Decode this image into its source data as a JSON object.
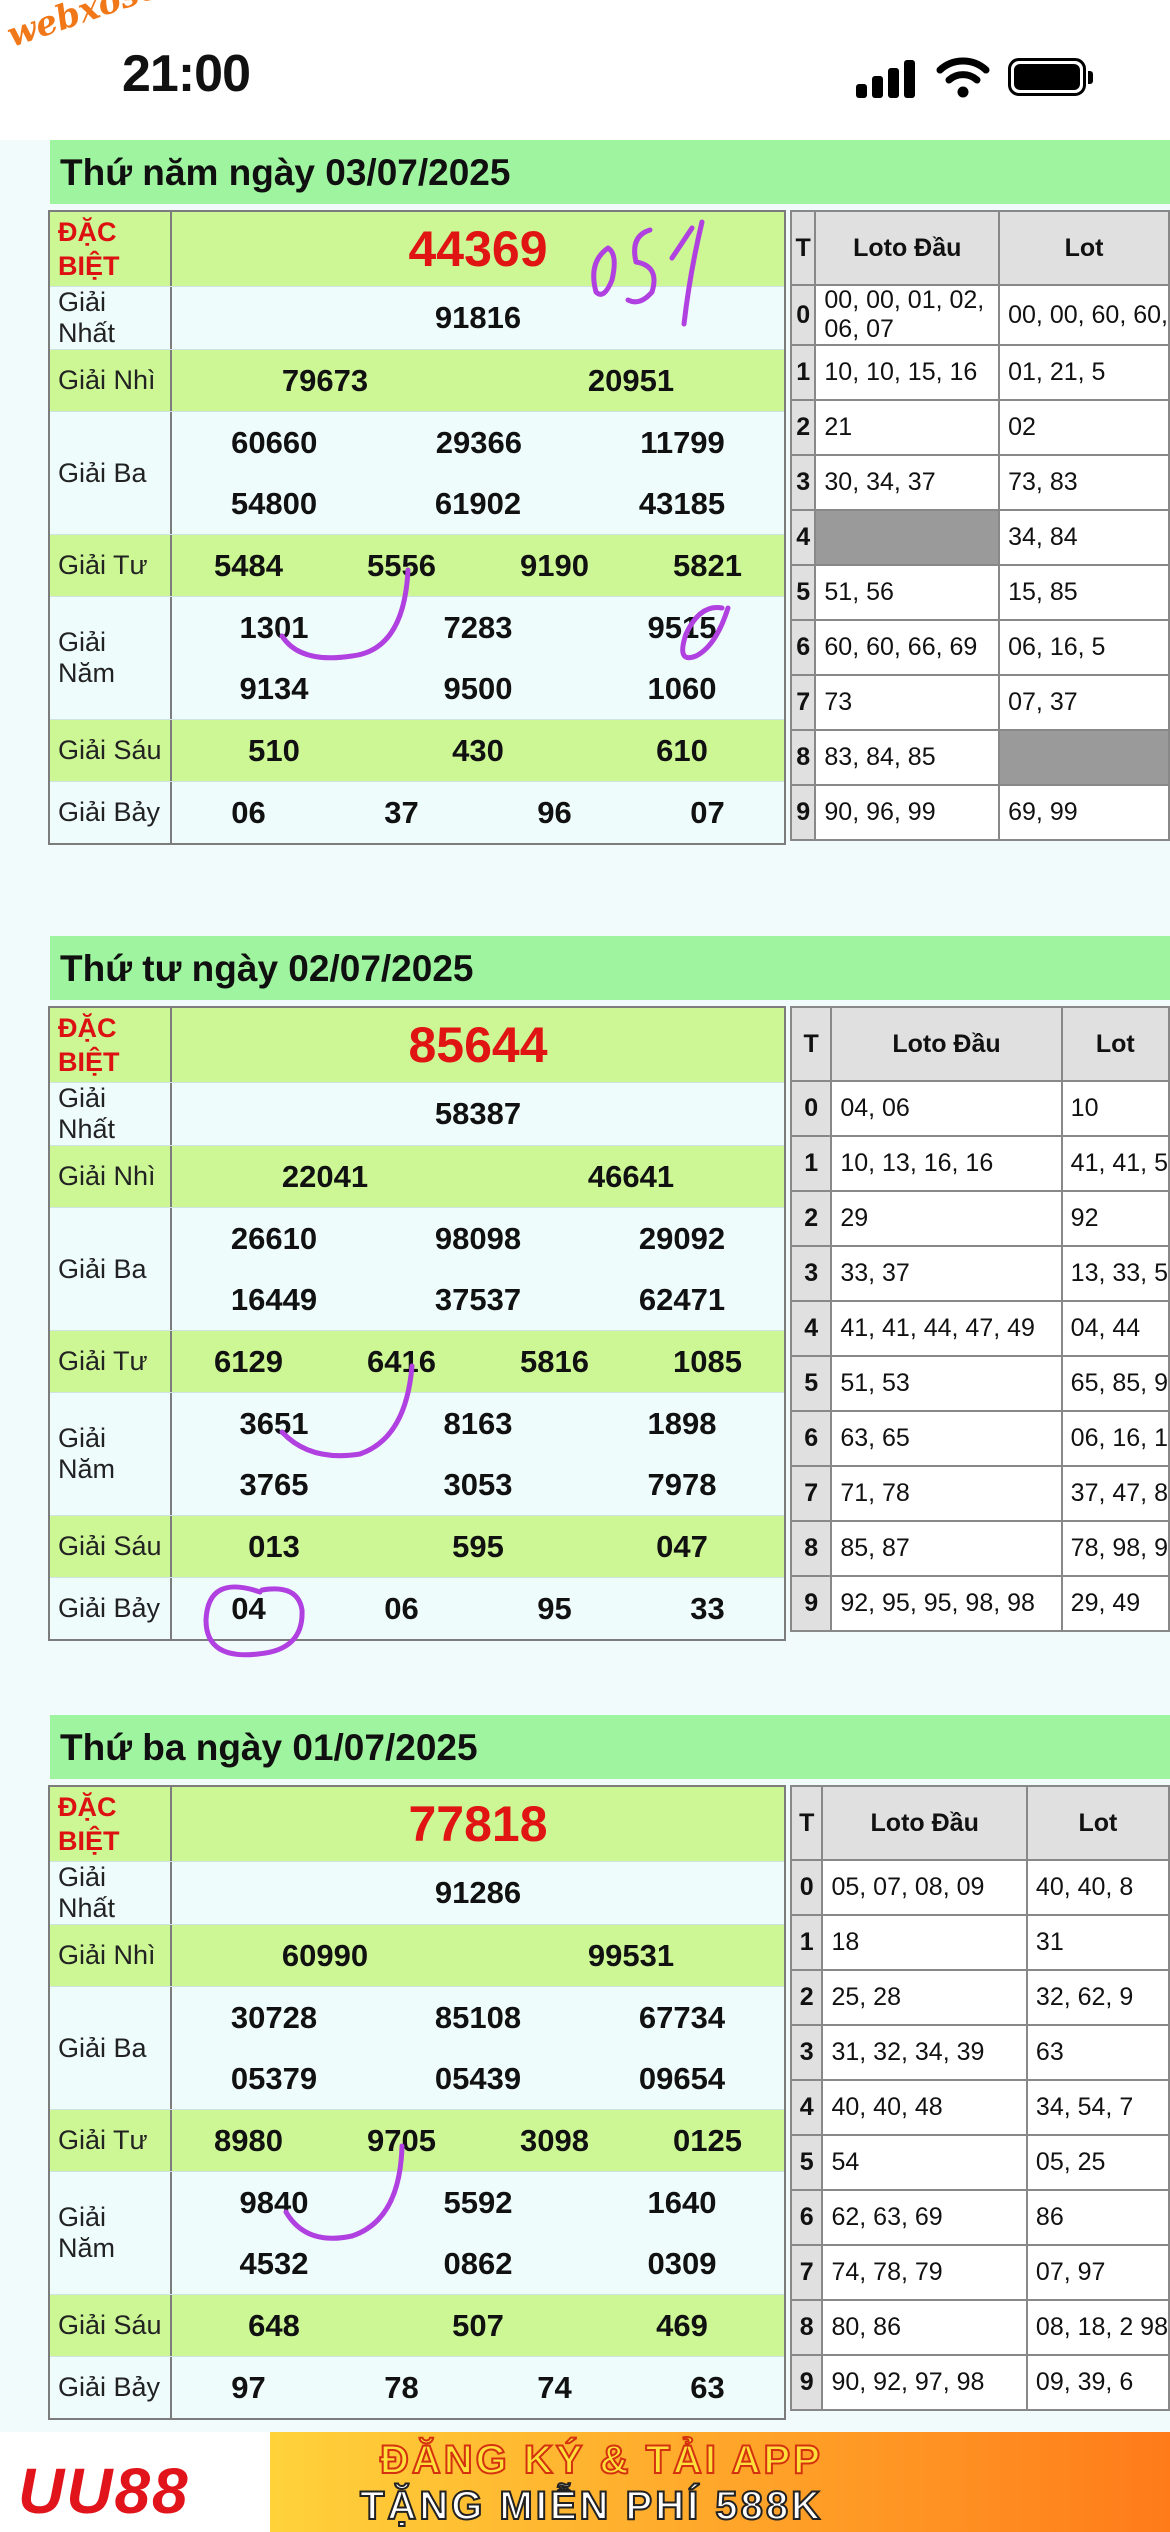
{
  "status_bar": {
    "time": "21:00",
    "watermark": "webxoso.net"
  },
  "loto_headers": {
    "digit": "T",
    "dau": "Loto Đầu",
    "duoi": "Lot"
  },
  "days": [
    {
      "title": "Thứ năm ngày 03/07/2025",
      "prizes": [
        {
          "label": "ĐẶC\nBIỆT",
          "special": true,
          "lines": [
            [
              "44369"
            ]
          ]
        },
        {
          "label": "Giải Nhất",
          "lines": [
            [
              "91816"
            ]
          ]
        },
        {
          "label": "Giải Nhì",
          "lines": [
            [
              "79673",
              "20951"
            ]
          ]
        },
        {
          "label": "Giải Ba",
          "lines": [
            [
              "60660",
              "29366",
              "11799"
            ],
            [
              "54800",
              "61902",
              "43185"
            ]
          ]
        },
        {
          "label": "Giải Tư",
          "lines": [
            [
              "5484",
              "5556",
              "9190",
              "5821"
            ]
          ]
        },
        {
          "label": "Giải Năm",
          "lines": [
            [
              "1301",
              "7283",
              "9515"
            ],
            [
              "9134",
              "9500",
              "1060"
            ]
          ]
        },
        {
          "label": "Giải Sáu",
          "lines": [
            [
              "510",
              "430",
              "610"
            ]
          ]
        },
        {
          "label": "Giải Bảy",
          "lines": [
            [
              "06",
              "37",
              "96",
              "07"
            ]
          ]
        }
      ],
      "loto": [
        {
          "d": "0",
          "dau": "00, 00, 01, 02, 06, 07",
          "duoi": "00, 00, 60, 60,"
        },
        {
          "d": "1",
          "dau": "10, 10, 15, 16",
          "duoi": "01, 21, 5"
        },
        {
          "d": "2",
          "dau": "21",
          "duoi": "02"
        },
        {
          "d": "3",
          "dau": "30, 34, 37",
          "duoi": "73, 83"
        },
        {
          "d": "4",
          "dau": "",
          "duoi": "34, 84"
        },
        {
          "d": "5",
          "dau": "51, 56",
          "duoi": "15, 85"
        },
        {
          "d": "6",
          "dau": "60, 60, 66, 69",
          "duoi": "06, 16, 5"
        },
        {
          "d": "7",
          "dau": "73",
          "duoi": "07, 37"
        },
        {
          "d": "8",
          "dau": "83, 84, 85",
          "duoi": ""
        },
        {
          "d": "9",
          "dau": "90, 96, 99",
          "duoi": "69, 99"
        }
      ]
    },
    {
      "title": "Thứ tư ngày 02/07/2025",
      "prizes": [
        {
          "label": "ĐẶC\nBIỆT",
          "special": true,
          "lines": [
            [
              "85644"
            ]
          ]
        },
        {
          "label": "Giải Nhất",
          "lines": [
            [
              "58387"
            ]
          ]
        },
        {
          "label": "Giải Nhì",
          "lines": [
            [
              "22041",
              "46641"
            ]
          ]
        },
        {
          "label": "Giải Ba",
          "lines": [
            [
              "26610",
              "98098",
              "29092"
            ],
            [
              "16449",
              "37537",
              "62471"
            ]
          ]
        },
        {
          "label": "Giải Tư",
          "lines": [
            [
              "6129",
              "6416",
              "5816",
              "1085"
            ]
          ]
        },
        {
          "label": "Giải Năm",
          "lines": [
            [
              "3651",
              "8163",
              "1898"
            ],
            [
              "3765",
              "3053",
              "7978"
            ]
          ]
        },
        {
          "label": "Giải Sáu",
          "lines": [
            [
              "013",
              "595",
              "047"
            ]
          ]
        },
        {
          "label": "Giải Bảy",
          "lines": [
            [
              "04",
              "06",
              "95",
              "33"
            ]
          ]
        }
      ],
      "loto": [
        {
          "d": "0",
          "dau": "04, 06",
          "duoi": "10"
        },
        {
          "d": "1",
          "dau": "10, 13, 16, 16",
          "duoi": "41, 41, 5"
        },
        {
          "d": "2",
          "dau": "29",
          "duoi": "92"
        },
        {
          "d": "3",
          "dau": "33, 37",
          "duoi": "13, 33, 5"
        },
        {
          "d": "4",
          "dau": "41, 41, 44, 47, 49",
          "duoi": "04, 44"
        },
        {
          "d": "5",
          "dau": "51, 53",
          "duoi": "65, 85, 9"
        },
        {
          "d": "6",
          "dau": "63, 65",
          "duoi": "06, 16, 1"
        },
        {
          "d": "7",
          "dau": "71, 78",
          "duoi": "37, 47, 8"
        },
        {
          "d": "8",
          "dau": "85, 87",
          "duoi": "78, 98, 9"
        },
        {
          "d": "9",
          "dau": "92, 95, 95, 98, 98",
          "duoi": "29, 49"
        }
      ]
    },
    {
      "title": "Thứ ba ngày 01/07/2025",
      "prizes": [
        {
          "label": "ĐẶC\nBIỆT",
          "special": true,
          "lines": [
            [
              "77818"
            ]
          ]
        },
        {
          "label": "Giải Nhất",
          "lines": [
            [
              "91286"
            ]
          ]
        },
        {
          "label": "Giải Nhì",
          "lines": [
            [
              "60990",
              "99531"
            ]
          ]
        },
        {
          "label": "Giải Ba",
          "lines": [
            [
              "30728",
              "85108",
              "67734"
            ],
            [
              "05379",
              "05439",
              "09654"
            ]
          ]
        },
        {
          "label": "Giải Tư",
          "lines": [
            [
              "8980",
              "9705",
              "3098",
              "0125"
            ]
          ]
        },
        {
          "label": "Giải Năm",
          "lines": [
            [
              "9840",
              "5592",
              "1640"
            ],
            [
              "4532",
              "0862",
              "0309"
            ]
          ]
        },
        {
          "label": "Giải Sáu",
          "lines": [
            [
              "648",
              "507",
              "469"
            ]
          ]
        },
        {
          "label": "Giải Bảy",
          "lines": [
            [
              "97",
              "78",
              "74",
              "63"
            ]
          ]
        }
      ],
      "loto": [
        {
          "d": "0",
          "dau": "05, 07, 08, 09",
          "duoi": "40, 40, 8"
        },
        {
          "d": "1",
          "dau": "18",
          "duoi": "31"
        },
        {
          "d": "2",
          "dau": "25, 28",
          "duoi": "32, 62, 9"
        },
        {
          "d": "3",
          "dau": "31, 32, 34, 39",
          "duoi": "63"
        },
        {
          "d": "4",
          "dau": "40, 40, 48",
          "duoi": "34, 54, 7"
        },
        {
          "d": "5",
          "dau": "54",
          "duoi": "05, 25"
        },
        {
          "d": "6",
          "dau": "62, 63, 69",
          "duoi": "86"
        },
        {
          "d": "7",
          "dau": "74, 78, 79",
          "duoi": "07, 97"
        },
        {
          "d": "8",
          "dau": "80, 86",
          "duoi": "08, 18, 2 98"
        },
        {
          "d": "9",
          "dau": "90, 92, 97, 98",
          "duoi": "09, 39, 6"
        }
      ]
    }
  ],
  "ad": {
    "logo": "UU88",
    "line1": "ĐĂNG KÝ & TẢI APP",
    "line2": "TẶNG MIỄN PHÍ 588K"
  },
  "colors": {
    "header_green": "#9ff59f",
    "row_green": "#ccf794",
    "special_red": "#e11414",
    "ink_purple": "#b040e0"
  }
}
